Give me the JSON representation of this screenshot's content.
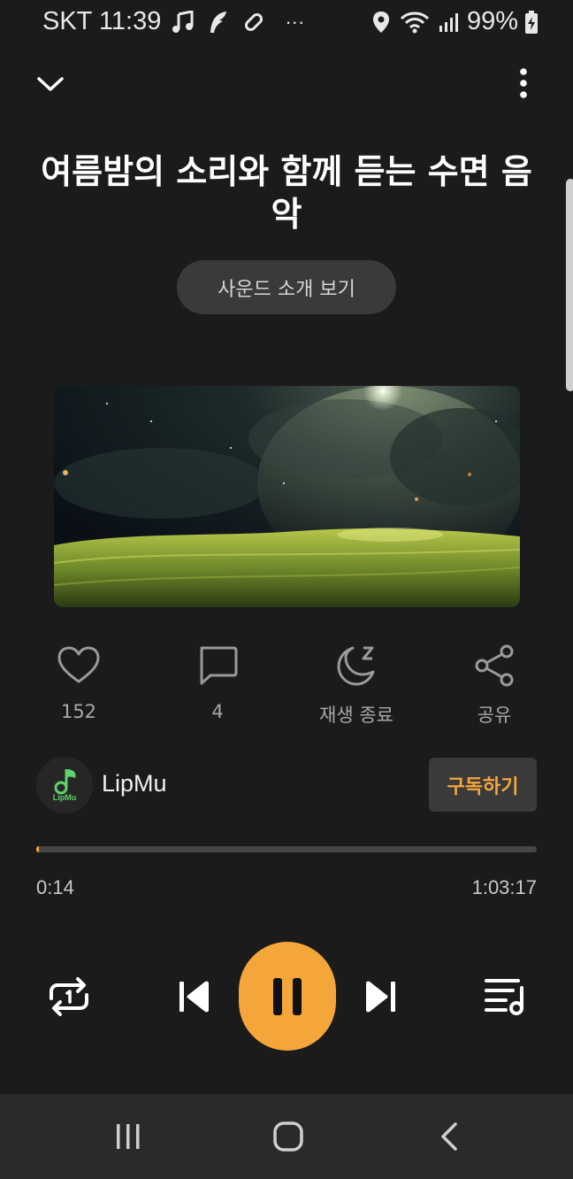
{
  "status_bar": {
    "carrier_time": "SKT 11:39",
    "overflow": "···",
    "battery": "99%",
    "icons": [
      "music-note-icon",
      "app-feather-icon",
      "link-icon",
      "location-icon",
      "wifi-icon",
      "signal-icon",
      "battery-charging-icon"
    ]
  },
  "header": {
    "collapse_icon": "chevron-down-icon",
    "more_icon": "more-vertical-icon"
  },
  "track": {
    "title": "여름밤의 소리와 함께 듣는 수면 음악",
    "intro_button": "사운드 소개 보기"
  },
  "actions": {
    "like_count": "152",
    "comment_count": "4",
    "sleep_timer_label": "재생 종료",
    "share_label": "공유"
  },
  "channel": {
    "name": "LipMu",
    "avatar_text": "LipMu",
    "subscribe_label": "구독하기"
  },
  "player": {
    "current_time": "0:14",
    "total_time": "1:03:17",
    "progress_fraction": 0.0037,
    "accent_color": "#f5a63a"
  },
  "nav": {
    "icons": [
      "recents-icon",
      "home-icon",
      "back-icon"
    ]
  }
}
